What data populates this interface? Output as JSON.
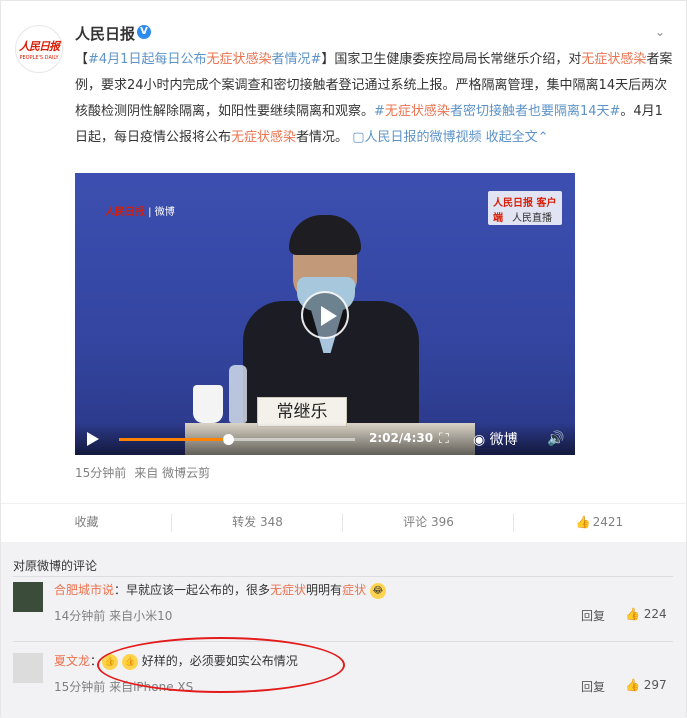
{
  "post": {
    "user_name": "人民日报",
    "avatar_text": "人民日报",
    "avatar_sub": "PEOPLE'S DAILY",
    "text_parts": {
      "p1": "【",
      "topic1": "#4月1日起每日公布",
      "hl1": "无症状感染",
      "topic1b": "者情况#",
      "p2": "】国家卫生健康委疾控局局长常继乐介绍，对",
      "hl2": "无症状感染",
      "p3": "者案例，要求24小时内完成个案调查和密切接触者登记通过系统上报。严格隔离管理，集中隔离14天后两次核酸检测阴性解除隔离，如阳性要继续隔离和观察。",
      "topic2a": "#",
      "hl3": "无症状感染",
      "topic2b": "者密切接触者也要隔离14天#",
      "p4": "。4月1日起，每日疫情公报将公布",
      "hl4": "无症状感染",
      "p5": "者情况。",
      "video_link": "人民日报的微博视频",
      "collapse": "收起全文"
    },
    "time": "15分钟前",
    "source": "来自 微博云剪"
  },
  "video": {
    "watermark_left": "人民日报",
    "watermark_left2": "微博",
    "badge_top": "人民日报 客户端",
    "badge_bottom": "人民直播",
    "nameplate": "常继乐",
    "time_display": "2:02/4:30",
    "progress": 0.46,
    "weibo_mark": "微博"
  },
  "actions": {
    "collect": "收藏",
    "forward": "转发 348",
    "comment": "评论 396",
    "like": "2421"
  },
  "comments": {
    "header": "对原微博的评论",
    "items": [
      {
        "name": "合肥城市说",
        "text_a": "：早就应该一起公布的，很多",
        "hl_a": "无症状",
        "text_b": "明明有",
        "hl_b": "症状",
        "meta": "14分钟前  来自小米10",
        "reply": "回复",
        "likes": "224"
      },
      {
        "name": "夏文龙",
        "text_a": "：",
        "text_b": "好样的，必须要如实公布情况",
        "meta": "15分钟前  来自iPhone XS",
        "reply": "回复",
        "likes": "297"
      }
    ]
  },
  "colors": {
    "accent": "#eb7350",
    "link": "#5d93c7",
    "annotation": "#e31b1b"
  }
}
